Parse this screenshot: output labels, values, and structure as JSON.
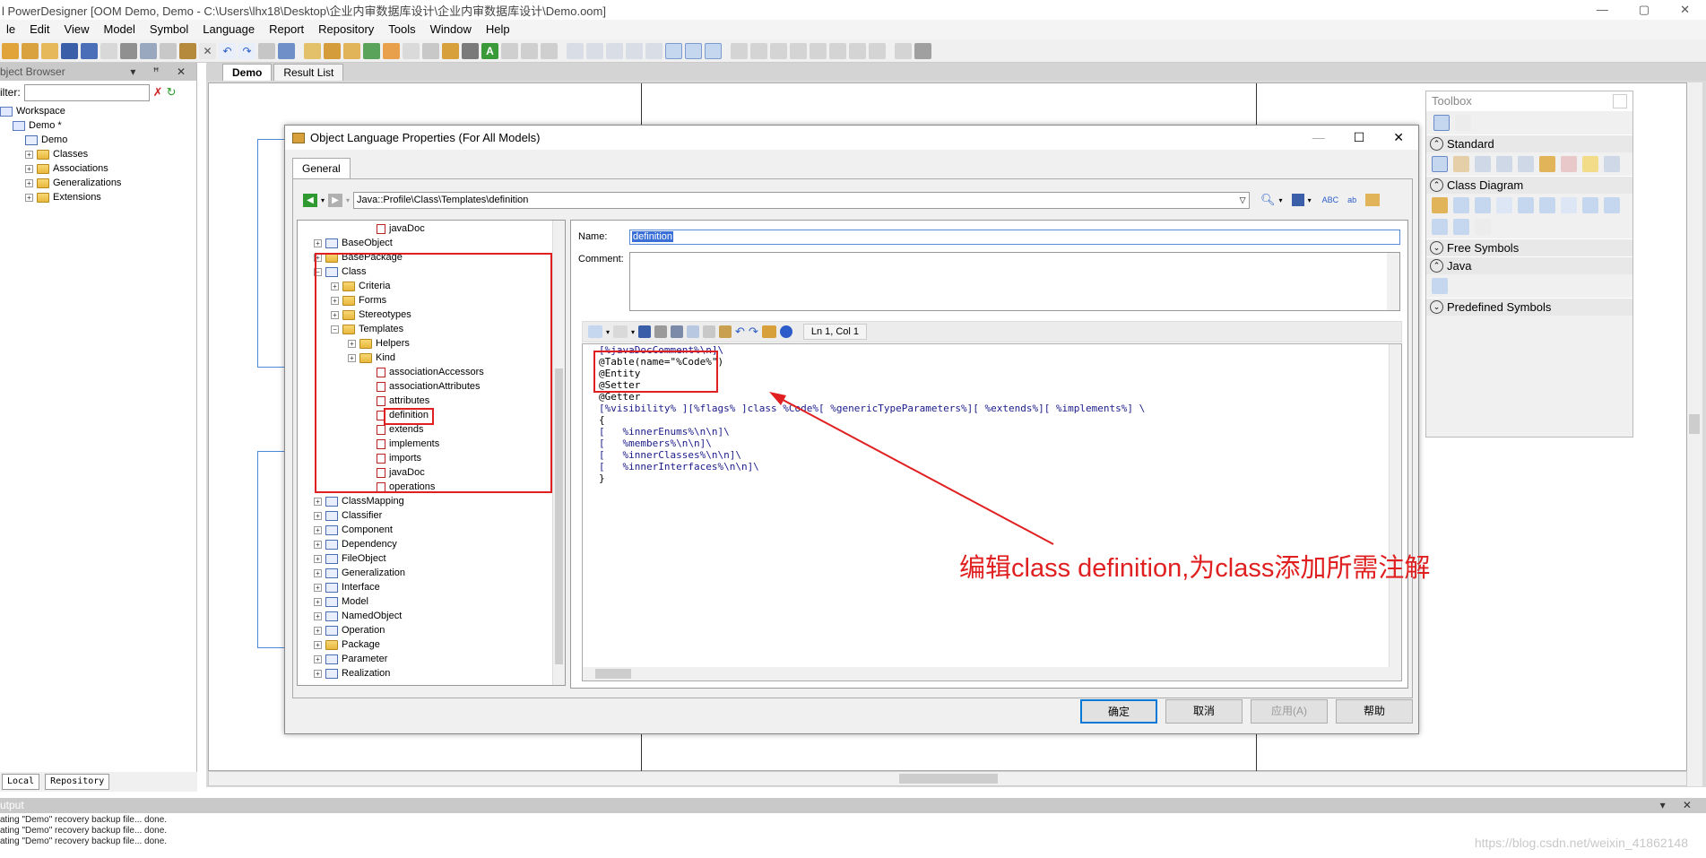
{
  "app": {
    "title": "l PowerDesigner [OOM Demo, Demo - C:\\Users\\lhx18\\Desktop\\企业内审数据库设计\\企业内审数据库设计\\Demo.oom]",
    "window_controls": [
      "—",
      "▢",
      "✕"
    ]
  },
  "menu": [
    "le",
    "Edit",
    "View",
    "Model",
    "Symbol",
    "Language",
    "Report",
    "Repository",
    "Tools",
    "Window",
    "Help"
  ],
  "object_browser": {
    "title": "bject Browser",
    "controls": "▾ ꟸ ✕",
    "filter_label": "ilter:",
    "filter_value": "",
    "tree": [
      {
        "label": "Workspace",
        "level": 0
      },
      {
        "label": "Demo *",
        "level": 1
      },
      {
        "label": "Demo",
        "level": 2
      },
      {
        "label": "Classes",
        "level": 2
      },
      {
        "label": "Associations",
        "level": 2
      },
      {
        "label": "Generalizations",
        "level": 2
      },
      {
        "label": "Extensions",
        "level": 2
      }
    ],
    "tabs": [
      "Local",
      "Repository"
    ]
  },
  "doc_tabs": [
    "Demo",
    "Result List"
  ],
  "dialog": {
    "title": "Object Language Properties (For All Models)",
    "tab": "General",
    "path": "Java::Profile\\Class\\Templates\\definition",
    "name_label": "Name:",
    "name_value": "definition",
    "comment_label": "Comment:",
    "cursor_pos": "Ln 1, Col 1",
    "tree": [
      {
        "label": "javaDoc",
        "level": 4,
        "icon": "template"
      },
      {
        "label": "BaseObject",
        "level": 1,
        "icon": "class"
      },
      {
        "label": "BasePackage",
        "level": 1,
        "icon": "folder"
      },
      {
        "label": "Class",
        "level": 1,
        "icon": "class"
      },
      {
        "label": "Criteria",
        "level": 2,
        "icon": "folder"
      },
      {
        "label": "Forms",
        "level": 2,
        "icon": "folder"
      },
      {
        "label": "Stereotypes",
        "level": 2,
        "icon": "folder"
      },
      {
        "label": "Templates",
        "level": 2,
        "icon": "folder"
      },
      {
        "label": "Helpers",
        "level": 3,
        "icon": "folder"
      },
      {
        "label": "Kind",
        "level": 3,
        "icon": "folder"
      },
      {
        "label": "associationAccessors",
        "level": 4,
        "icon": "template"
      },
      {
        "label": "associationAttributes",
        "level": 4,
        "icon": "template"
      },
      {
        "label": "attributes",
        "level": 4,
        "icon": "template"
      },
      {
        "label": "definition",
        "level": 4,
        "icon": "template"
      },
      {
        "label": "extends",
        "level": 4,
        "icon": "template"
      },
      {
        "label": "implements",
        "level": 4,
        "icon": "template"
      },
      {
        "label": "imports",
        "level": 4,
        "icon": "template"
      },
      {
        "label": "javaDoc",
        "level": 4,
        "icon": "template"
      },
      {
        "label": "operations",
        "level": 4,
        "icon": "template"
      },
      {
        "label": "ClassMapping",
        "level": 1,
        "icon": "class"
      },
      {
        "label": "Classifier",
        "level": 1,
        "icon": "class"
      },
      {
        "label": "Component",
        "level": 1,
        "icon": "class"
      },
      {
        "label": "Dependency",
        "level": 1,
        "icon": "class"
      },
      {
        "label": "FileObject",
        "level": 1,
        "icon": "class"
      },
      {
        "label": "Generalization",
        "level": 1,
        "icon": "class"
      },
      {
        "label": "Interface",
        "level": 1,
        "icon": "class"
      },
      {
        "label": "Model",
        "level": 1,
        "icon": "class"
      },
      {
        "label": "NamedObject",
        "level": 1,
        "icon": "class"
      },
      {
        "label": "Operation",
        "level": 1,
        "icon": "class"
      },
      {
        "label": "Package",
        "level": 1,
        "icon": "folder"
      },
      {
        "label": "Parameter",
        "level": 1,
        "icon": "class"
      },
      {
        "label": "Realization",
        "level": 1,
        "icon": "class"
      }
    ],
    "code_lines": [
      "[%javaDocComment%\\n]\\",
      "@Table(name=\"%Code%\")",
      "@Entity",
      "@Setter",
      "@Getter",
      "[%visibility% ][%flags% ]class %Code%[ %genericTypeParameters%][ %extends%][ %implements%] \\",
      "{",
      "[   %innerEnums%\\n\\n]\\",
      "[   %members%\\n\\n]\\",
      "[   %innerClasses%\\n\\n]\\",
      "[   %innerInterfaces%\\n\\n]\\",
      "}"
    ],
    "buttons": {
      "ok": "确定",
      "cancel": "取消",
      "apply": "应用(A)",
      "help": "帮助"
    }
  },
  "annotation": "编辑class definition,为class添加所需注解",
  "toolbox": {
    "title": "Toolbox",
    "sections": [
      "Standard",
      "Class Diagram",
      "Free Symbols",
      "Java",
      "Predefined Symbols"
    ]
  },
  "output": {
    "title": "utput",
    "lines": [
      "ating \"Demo\" recovery backup file... done.",
      "ating \"Demo\" recovery backup file... done.",
      "ating \"Demo\" recovery backup file... done."
    ]
  },
  "watermark": "https://blog.csdn.net/weixin_41862148",
  "colors": {
    "annotation_red": "#e02020",
    "selection_blue": "#3a6fd8",
    "macro_blue": "#0000c0"
  }
}
